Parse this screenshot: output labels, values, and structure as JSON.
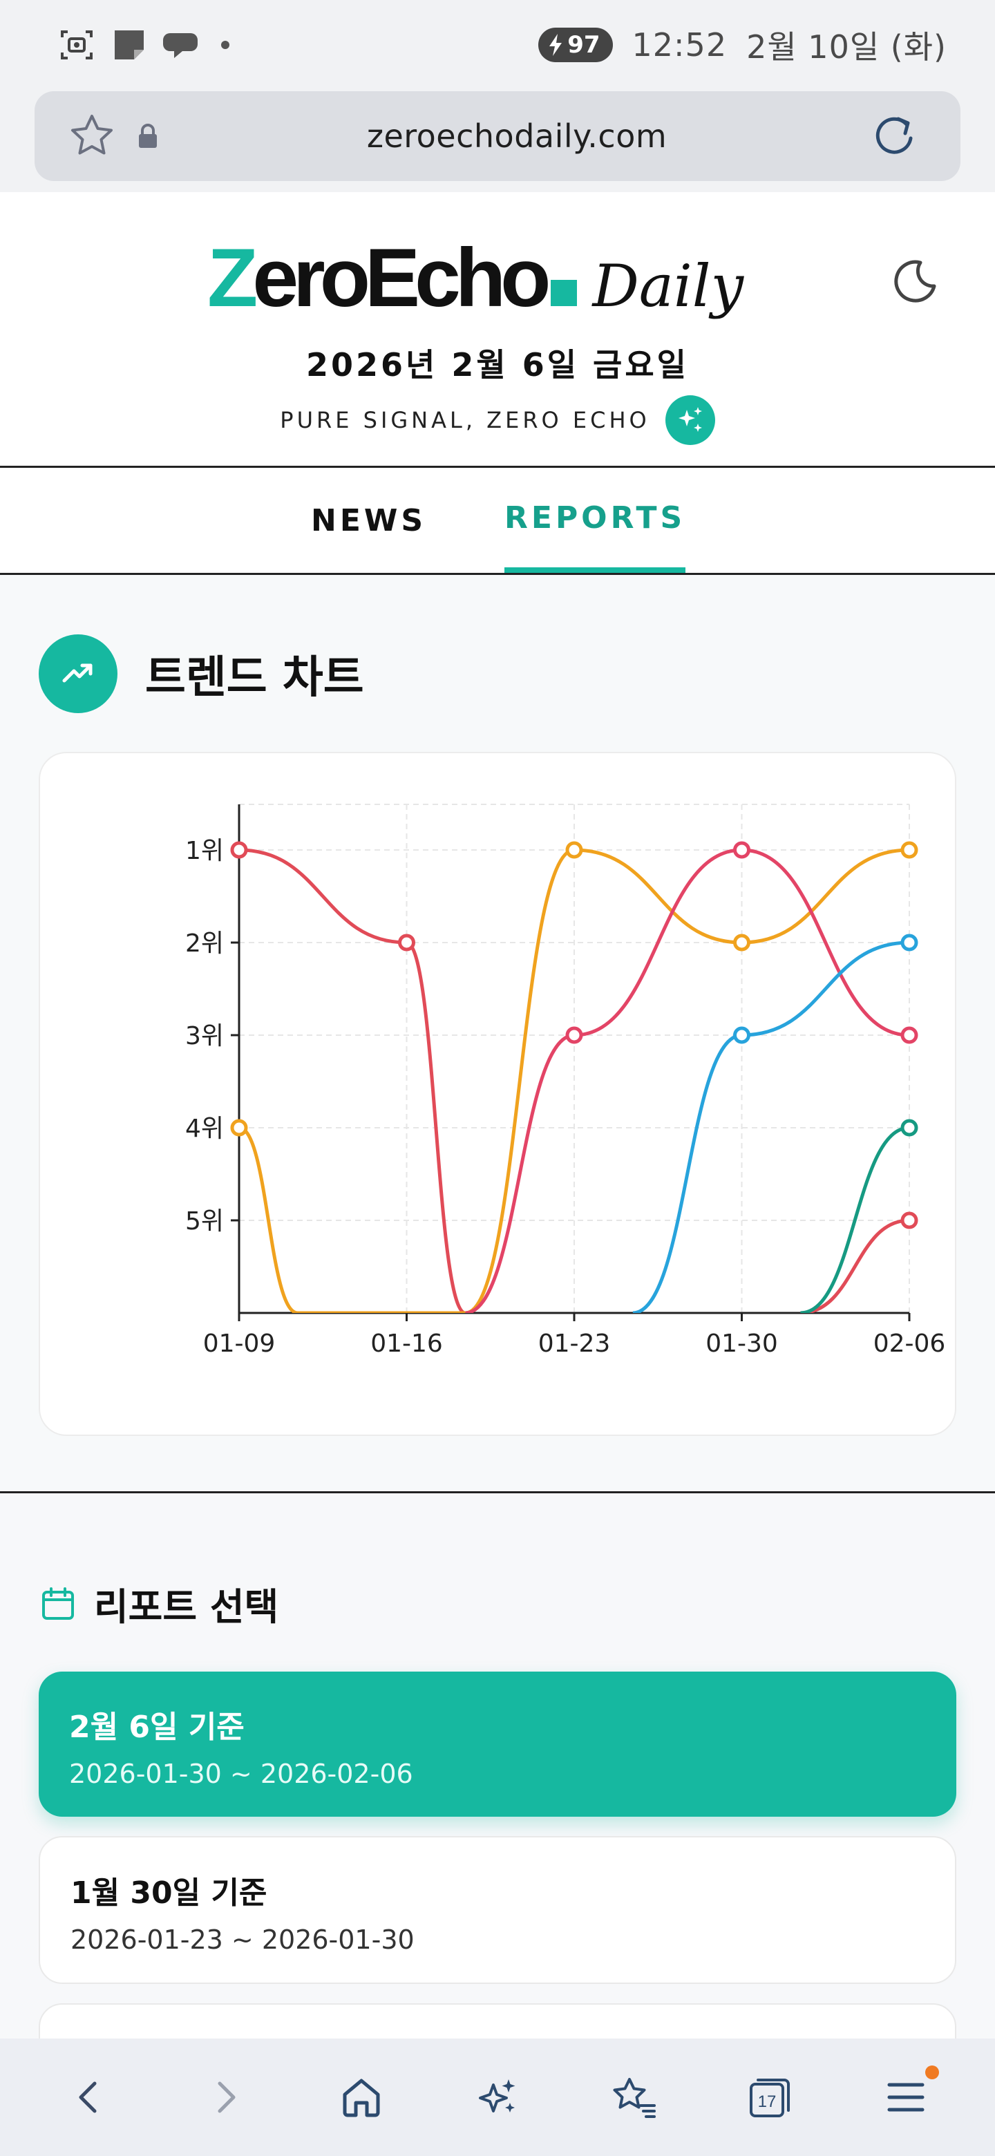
{
  "status_bar": {
    "battery": "97",
    "time": "12:52",
    "date": "2월 10일 (화)"
  },
  "browser": {
    "url": "zeroechodaily.com",
    "tab_count": "17"
  },
  "header": {
    "logo_main_first": "Z",
    "logo_main_rest": "eroEcho",
    "logo_daily": "Daily",
    "date": "2026년 2월 6일 금요일",
    "tagline": "PURE SIGNAL, ZERO ECHO"
  },
  "tabs": [
    {
      "label": "NEWS",
      "active": false
    },
    {
      "label": "REPORTS",
      "active": true
    }
  ],
  "trend": {
    "title": "트렌드 차트"
  },
  "chart_data": {
    "type": "line",
    "x": [
      "01-09",
      "01-16",
      "01-23",
      "01-30",
      "02-06"
    ],
    "y_ticks": [
      "1위",
      "2위",
      "3위",
      "4위",
      "5위"
    ],
    "ylim": [
      1,
      6
    ],
    "y_inverted": true,
    "grid": true,
    "series": [
      {
        "color": "#e14b57",
        "values": [
          1,
          2,
          null,
          null,
          null
        ]
      },
      {
        "color": "#f0a21e",
        "values": [
          4,
          null,
          1,
          2,
          1
        ]
      },
      {
        "color": "#e34466",
        "values": [
          null,
          null,
          3,
          1,
          3
        ]
      },
      {
        "color": "#27a3dc",
        "values": [
          null,
          null,
          null,
          3,
          2
        ]
      },
      {
        "color": "#e14b57",
        "values": [
          null,
          null,
          null,
          null,
          5
        ]
      },
      {
        "color": "#169a82",
        "values": [
          null,
          null,
          null,
          null,
          4
        ]
      }
    ]
  },
  "reports": {
    "title": "리포트 선택",
    "items": [
      {
        "title": "2월 6일 기준",
        "range": "2026-01-30 ~ 2026-02-06",
        "active": true
      },
      {
        "title": "1월 30일 기준",
        "range": "2026-01-23 ~ 2026-01-30",
        "active": false
      }
    ]
  },
  "icons": {
    "accent": "#16b8a0"
  }
}
